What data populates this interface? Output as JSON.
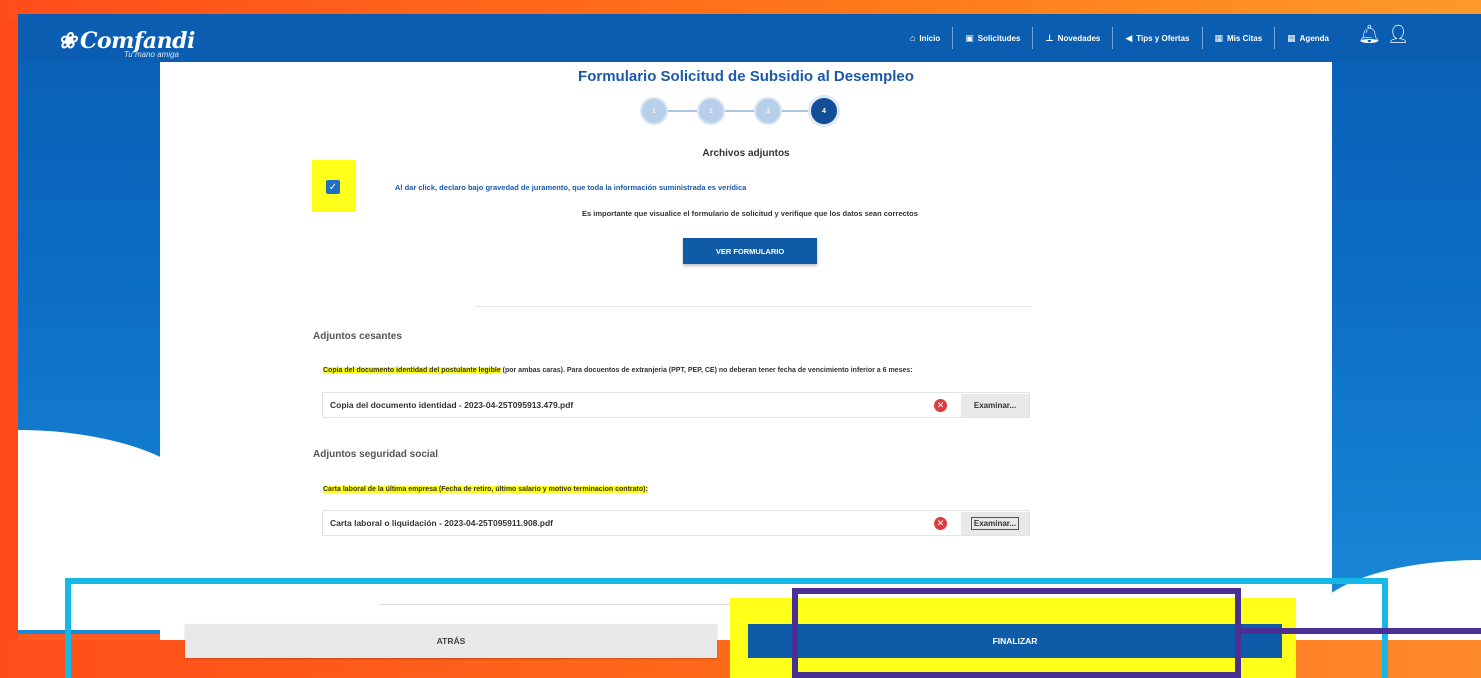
{
  "brand": {
    "name": "Comfandi",
    "tagline": "Tu mano amiga",
    "colors": {
      "primary": "#0a5db0",
      "highlight": "#ffff1a",
      "frame": "#16b8e8",
      "annotation": "#4a2f95",
      "orange": "#ff5a1f"
    }
  },
  "nav": {
    "items": [
      {
        "label": "Inicio",
        "icon": "home-icon"
      },
      {
        "label": "Solicitudes",
        "icon": "document-icon"
      },
      {
        "label": "Novedades",
        "icon": "pin-icon"
      },
      {
        "label": "Tips y Ofertas",
        "icon": "megaphone-icon"
      },
      {
        "label": "Mis Citas",
        "icon": "calendar-icon"
      },
      {
        "label": "Agenda",
        "icon": "calendar-icon"
      }
    ],
    "right_icons": [
      "bell-icon",
      "user-icon"
    ]
  },
  "form": {
    "title": "Formulario Solicitud de Subsidio al Desempleo",
    "steps": [
      {
        "label": "1",
        "state": "completed"
      },
      {
        "label": "2",
        "state": "completed"
      },
      {
        "label": "3",
        "state": "completed"
      },
      {
        "label": "4",
        "state": "active"
      }
    ],
    "section_title": "Archivos adjuntos",
    "declaration_checked": true,
    "declaration_text": "Al dar click, declaro bajo gravedad de juramento, que toda la información suministrada es verídica",
    "notice_text": "Es importante que visualice el formulario de solicitud y verifique que los datos sean correctos",
    "view_button": "VER FORMULARIO"
  },
  "attachments": {
    "cesantes": {
      "title": "Adjuntos cesantes",
      "instruction_highlight": "Copia del documento identidad del postulante legible",
      "instruction_rest": " (por ambas caras). Para docuentos de extranjeria (PPT, PEP, CE) no deberan tener fecha de vencimiento inferior a 6 meses:",
      "file_name": "Copia del documento identidad - 2023-04-25T095913.479.pdf",
      "browse_label": "Examinar..."
    },
    "seguridad_social": {
      "title": "Adjuntos seguridad social",
      "instruction_highlight": "Carta laboral de la última empresa (Fecha de retiro, último salario y motivo terminacion contrato):",
      "file_name": "Carta laboral o liquidación - 2023-04-25T095911.908.pdf",
      "browse_label": "Examinar..."
    }
  },
  "actions": {
    "back": "ATRÁS",
    "finish": "FINALIZAR"
  }
}
